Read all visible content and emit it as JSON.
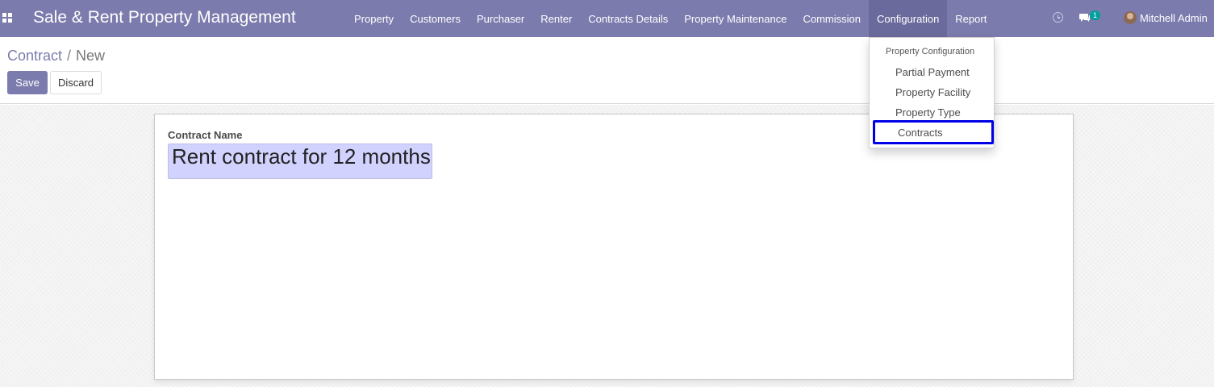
{
  "app": {
    "title": "Sale & Rent Property Management",
    "apps_icon": "apps-grid-icon"
  },
  "menu": {
    "items": [
      {
        "label": "Property"
      },
      {
        "label": "Customers"
      },
      {
        "label": "Purchaser"
      },
      {
        "label": "Renter"
      },
      {
        "label": "Contracts Details"
      },
      {
        "label": "Property Maintenance"
      },
      {
        "label": "Commission"
      },
      {
        "label": "Configuration",
        "active": true
      },
      {
        "label": "Report"
      }
    ]
  },
  "systray": {
    "activity_icon": "clock-icon",
    "messages_icon": "chat-icon",
    "messages_count": "1",
    "user_name": "Mitchell Admin"
  },
  "breadcrumb": {
    "parent": "Contract",
    "separator": "/",
    "current": "New"
  },
  "buttons": {
    "save": "Save",
    "discard": "Discard"
  },
  "form": {
    "contract_name_label": "Contract Name",
    "contract_name_value": "Rent contract for 12 months"
  },
  "dropdown": {
    "header": "Property Configuration",
    "items": [
      {
        "label": "Partial Payment"
      },
      {
        "label": "Property Facility"
      },
      {
        "label": "Property Type"
      },
      {
        "label": "Contracts",
        "highlighted": true
      }
    ]
  },
  "colors": {
    "navbar": "#7c7bad",
    "active_menu": "#6b6a9c",
    "input_bg": "#d2d2ff",
    "highlight_border": "#0000e6",
    "badge": "#00a09d"
  }
}
